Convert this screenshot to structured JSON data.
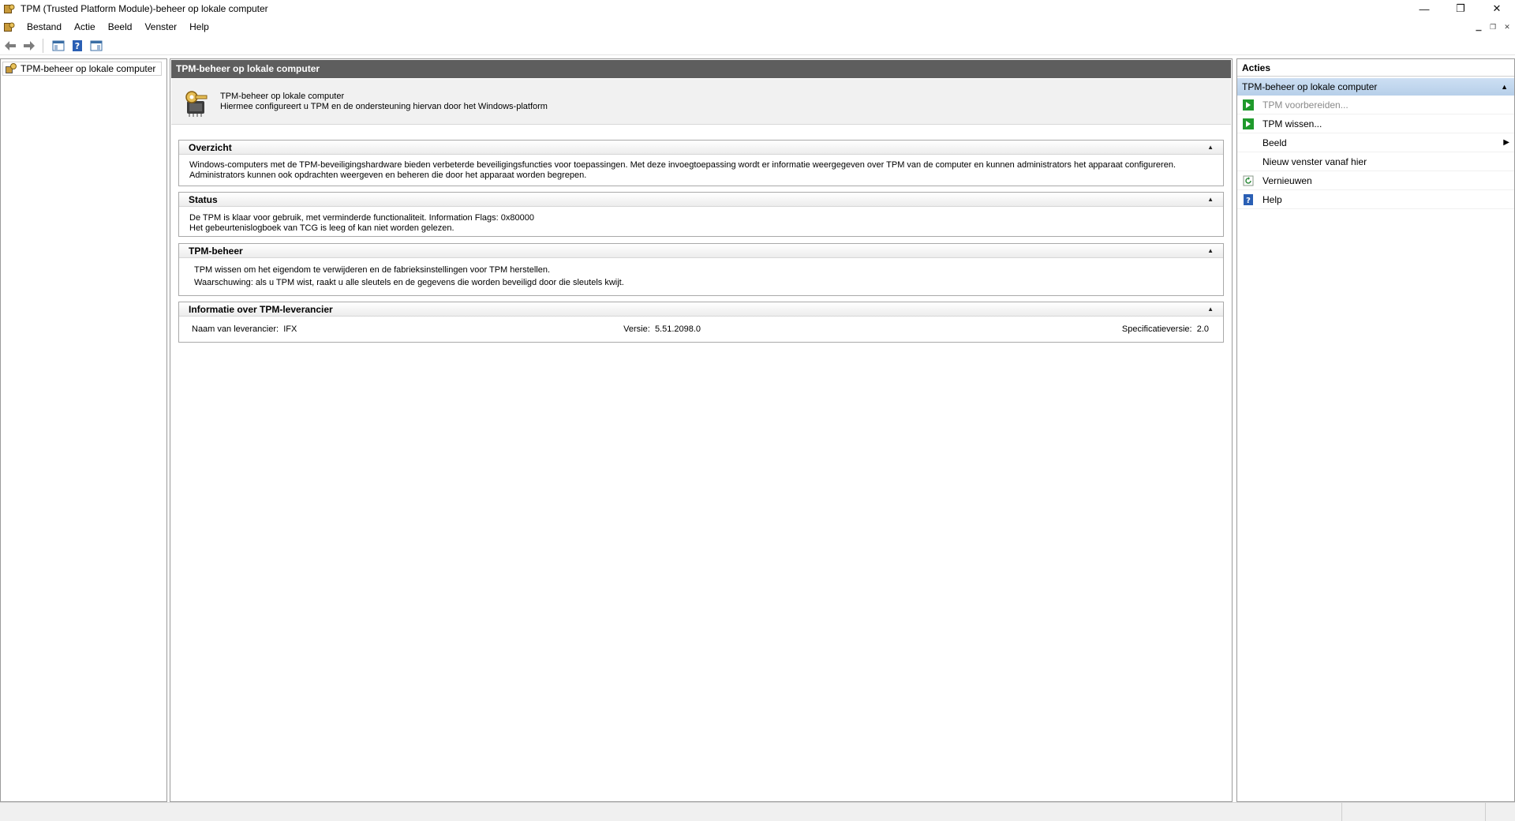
{
  "window": {
    "title": "TPM (Trusted Platform Module)-beheer op lokale computer",
    "controls": {
      "minimize": "—",
      "restore": "❐",
      "close": "✕"
    }
  },
  "menu": {
    "items": [
      "Bestand",
      "Actie",
      "Beeld",
      "Venster",
      "Help"
    ]
  },
  "tree": {
    "root": "TPM-beheer op lokale computer"
  },
  "center": {
    "header": "TPM-beheer op lokale computer",
    "intro_title": "TPM-beheer op lokale computer",
    "intro_desc": "Hiermee configureert u TPM en de ondersteuning hiervan door het Windows-platform",
    "overview": {
      "heading": "Overzicht",
      "text": "Windows-computers met de TPM-beveiligingshardware bieden verbeterde beveiligingsfuncties voor toepassingen. Met deze invoegtoepassing wordt er informatie weergegeven over TPM van de computer en kunnen administrators het apparaat configureren. Administrators kunnen ook opdrachten weergeven en beheren die door het apparaat worden begrepen."
    },
    "status": {
      "heading": "Status",
      "line1": "De TPM is klaar voor gebruik, met verminderde functionaliteit. Information Flags: 0x80000",
      "line2": "Het gebeurtenislogboek van TCG is leeg of kan niet worden gelezen."
    },
    "management": {
      "heading": "TPM-beheer",
      "line1": "TPM wissen om het eigendom te verwijderen en de fabrieksinstellingen voor TPM herstellen.",
      "line2": "Waarschuwing: als u TPM wist, raakt u alle sleutels en de gegevens die worden beveiligd door die sleutels kwijt."
    },
    "vendor": {
      "heading": "Informatie over TPM-leverancier",
      "name_label": "Naam van leverancier:",
      "name_value": "IFX",
      "version_label": "Versie:",
      "version_value": "5.51.2098.0",
      "spec_label": "Specificatieversie:",
      "spec_value": "2.0"
    }
  },
  "actions": {
    "heading": "Acties",
    "group": "TPM-beheer op lokale computer",
    "items": [
      {
        "label": "TPM voorbereiden...",
        "icon": "green-arrow-icon",
        "disabled": true
      },
      {
        "label": "TPM wissen...",
        "icon": "green-arrow-icon",
        "disabled": false
      },
      {
        "label": "Beeld",
        "icon": "",
        "disabled": false,
        "submenu": true
      },
      {
        "label": "Nieuw venster vanaf hier",
        "icon": "",
        "disabled": false
      },
      {
        "label": "Vernieuwen",
        "icon": "refresh-icon",
        "disabled": false
      },
      {
        "label": "Help",
        "icon": "help-icon",
        "disabled": false
      }
    ]
  }
}
